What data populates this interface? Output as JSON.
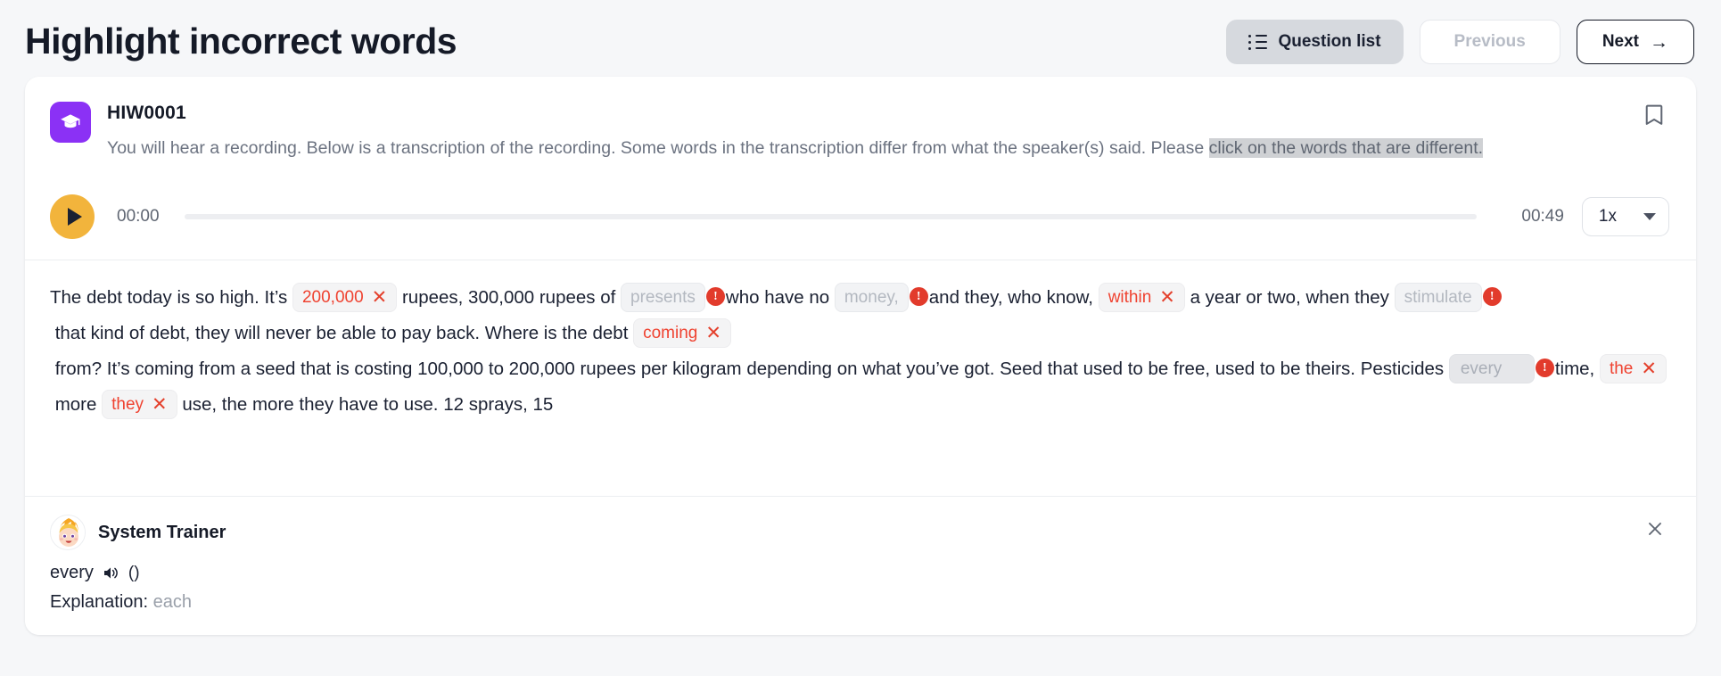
{
  "header": {
    "title": "Highlight incorrect words",
    "question_list_label": "Question list",
    "previous_label": "Previous",
    "next_label": "Next",
    "next_arrow": "→",
    "list_icon": "list-icon",
    "arrow_icon": "arrow-right-icon"
  },
  "question": {
    "code": "HIW0001",
    "icon": "graduation-cap-icon",
    "bookmark_icon": "bookmark-icon",
    "instruction_plain": "You will hear a recording. Below is a transcription of the recording. Some words in the transcription differ from what the speaker(s) said. Please ",
    "instruction_selected": "click on the words that are different."
  },
  "player": {
    "play_icon": "play-icon",
    "current_time": "00:00",
    "duration": "00:49",
    "speed": "1x",
    "speed_caret_icon": "chevron-down-icon",
    "progress_percent": 0
  },
  "transcript": {
    "tokens": [
      {
        "type": "text",
        "text": "The debt today is so high. It’s "
      },
      {
        "type": "chip-red",
        "text": "200,000",
        "mark": "✕"
      },
      {
        "type": "text",
        "text": " rupees, 300,000 rupees of "
      },
      {
        "type": "chip-gray",
        "text": "presents"
      },
      {
        "type": "alert",
        "text": "!"
      },
      {
        "type": "text",
        "text": "who have no "
      },
      {
        "type": "chip-gray",
        "text": "money,"
      },
      {
        "type": "alert",
        "text": "!"
      },
      {
        "type": "text",
        "text": "and they, who know, "
      },
      {
        "type": "chip-red",
        "text": "within",
        "mark": "✕"
      },
      {
        "type": "text",
        "text": " a year or two, when they "
      },
      {
        "type": "chip-gray",
        "text": "stimulate"
      },
      {
        "type": "alert",
        "text": "!"
      },
      {
        "type": "text",
        "text": " that kind of debt, they will never be able to pay back. Where is the debt "
      },
      {
        "type": "chip-red",
        "text": "coming",
        "mark": "✕"
      },
      {
        "type": "text",
        "text": " from? It’s coming from a seed that is costing 100,000 to 200,000 rupees per kilogram depending on what you’ve got. Seed that used to be free, used to be theirs. Pesticides "
      },
      {
        "type": "chip-gray-wide",
        "text": "every"
      },
      {
        "type": "alert",
        "text": "!"
      },
      {
        "type": "text",
        "text": "time, "
      },
      {
        "type": "chip-red",
        "text": "the",
        "mark": "✕"
      },
      {
        "type": "text",
        "text": " more "
      },
      {
        "type": "chip-red",
        "text": "they",
        "mark": "✕"
      },
      {
        "type": "text",
        "text": " use, the more they have to use. 12 sprays, 15"
      }
    ]
  },
  "trainer": {
    "avatar_icon": "trainer-avatar",
    "name": "System Trainer",
    "word": "every",
    "speaker_icon": "speaker-icon",
    "parens": "()",
    "explanation_label": "Explanation:",
    "explanation_value": "each",
    "close_icon": "close-icon"
  },
  "colors": {
    "accent_purple": "#8b31f5",
    "play_yellow": "#f2b43c",
    "error_red": "#e4402c",
    "title_dark": "#151a27",
    "muted_gray": "#6b7280",
    "page_bg": "#f6f7f9"
  }
}
